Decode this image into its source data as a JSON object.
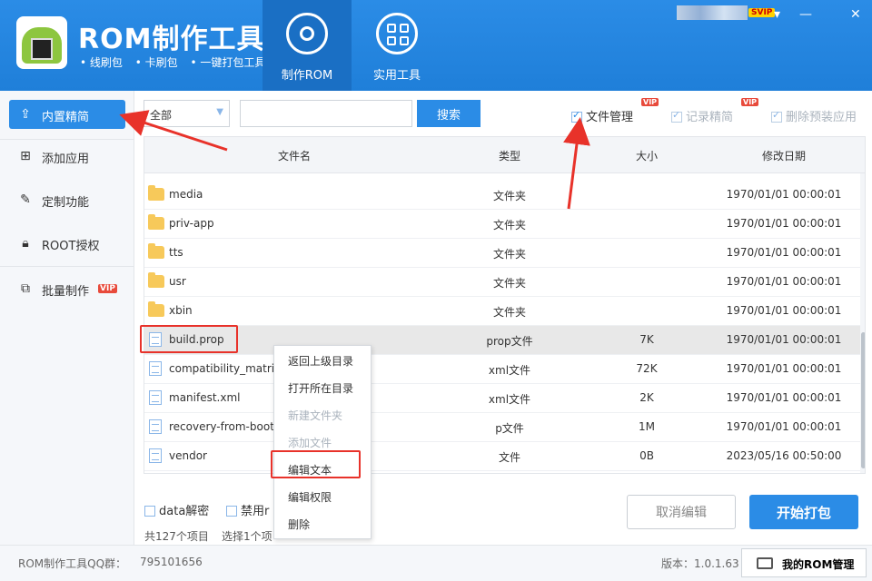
{
  "header": {
    "title": "ROM制作工具",
    "subtitle": [
      "• 线刷包",
      "• 卡刷包",
      "• 一键打包工具"
    ],
    "badge": "SVIP",
    "nav": [
      {
        "label": "制作ROM",
        "icon": "gear-icon",
        "active": true
      },
      {
        "label": "实用工具",
        "icon": "grid-icon",
        "active": false
      }
    ],
    "window_controls": [
      "▾",
      "—",
      "✕"
    ]
  },
  "sidebar": {
    "items": [
      {
        "label": "内置精简",
        "icon": "export-icon",
        "active": true
      },
      {
        "label": "添加应用",
        "icon": "add-box-icon"
      },
      {
        "label": "定制功能",
        "icon": "edit-document-icon"
      },
      {
        "label": "ROOT授权",
        "icon": "lock-icon"
      },
      {
        "label": "批量制作",
        "icon": "batch-icon",
        "vip": "VIP"
      }
    ]
  },
  "toolbar": {
    "filter_value": "全部",
    "search_value": "",
    "search_label": "搜索",
    "options": [
      {
        "label": "文件管理",
        "checked": true,
        "vip": "VIP",
        "enabled": true
      },
      {
        "label": "记录精简",
        "checked": true,
        "vip": "VIP",
        "enabled": false
      },
      {
        "label": "删除预装应用",
        "checked": true,
        "enabled": false
      }
    ]
  },
  "table": {
    "headers": [
      "文件名",
      "类型",
      "大小",
      "修改日期"
    ],
    "rows": [
      {
        "name": "media",
        "type": "文件夹",
        "size": "",
        "date": "1970/01/01 00:00:01",
        "kind": "folder"
      },
      {
        "name": "priv-app",
        "type": "文件夹",
        "size": "",
        "date": "1970/01/01 00:00:01",
        "kind": "folder"
      },
      {
        "name": "tts",
        "type": "文件夹",
        "size": "",
        "date": "1970/01/01 00:00:01",
        "kind": "folder"
      },
      {
        "name": "usr",
        "type": "文件夹",
        "size": "",
        "date": "1970/01/01 00:00:01",
        "kind": "folder"
      },
      {
        "name": "xbin",
        "type": "文件夹",
        "size": "",
        "date": "1970/01/01 00:00:01",
        "kind": "folder"
      },
      {
        "name": "build.prop",
        "type": "prop文件",
        "size": "7K",
        "date": "1970/01/01 00:00:01",
        "kind": "file",
        "selected": true
      },
      {
        "name": "compatibility_matrix",
        "type": "xml文件",
        "size": "72K",
        "date": "1970/01/01 00:00:01",
        "kind": "file"
      },
      {
        "name": "manifest.xml",
        "type": "xml文件",
        "size": "2K",
        "date": "1970/01/01 00:00:01",
        "kind": "file"
      },
      {
        "name": "recovery-from-boot",
        "type": "p文件",
        "size": "1M",
        "date": "1970/01/01 00:00:01",
        "kind": "file"
      },
      {
        "name": "vendor",
        "type": "文件",
        "size": "0B",
        "date": "2023/05/16 00:50:00",
        "kind": "file"
      }
    ]
  },
  "context_menu": {
    "items": [
      {
        "label": "返回上级目录",
        "enabled": true
      },
      {
        "label": "打开所在目录",
        "enabled": true
      },
      {
        "label": "新建文件夹",
        "enabled": false
      },
      {
        "label": "添加文件",
        "enabled": false
      },
      {
        "label": "编辑文本",
        "enabled": true,
        "highlighted": true
      },
      {
        "label": "编辑权限",
        "enabled": true
      },
      {
        "label": "删除",
        "enabled": true
      }
    ]
  },
  "footer": {
    "data_decrypt": "data解密",
    "disable_prefix": "禁用r",
    "total": "共127个项目",
    "selected": "选择1个项",
    "cancel_label": "取消编辑",
    "pack_label": "开始打包"
  },
  "statusbar": {
    "qq_label": "ROM制作工具QQ群：",
    "qq_number": "795101656",
    "version": "版本：1.0.1.63",
    "rom_manager": "我的ROM管理"
  },
  "colors": {
    "accent": "#2b8ce6",
    "annotation": "#e8322a",
    "vip": "#e84a3b"
  }
}
